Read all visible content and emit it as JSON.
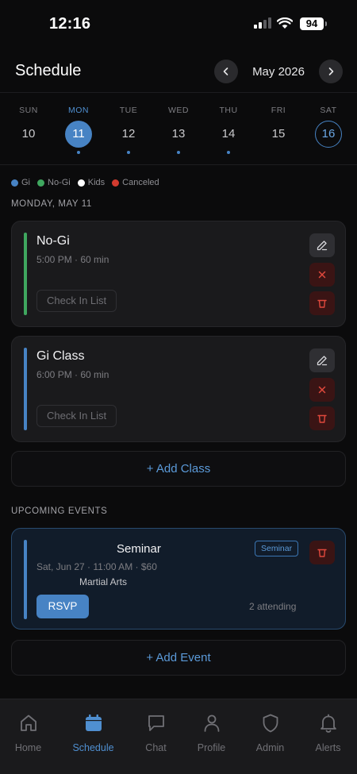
{
  "status_bar": {
    "time": "12:16",
    "battery": "94"
  },
  "header": {
    "title": "Schedule",
    "month": "May 2026"
  },
  "week": [
    {
      "name": "SUN",
      "num": "10",
      "selected": false,
      "today": false,
      "dot": false
    },
    {
      "name": "MON",
      "num": "11",
      "selected": true,
      "today": false,
      "dot": true
    },
    {
      "name": "TUE",
      "num": "12",
      "selected": false,
      "today": false,
      "dot": true
    },
    {
      "name": "WED",
      "num": "13",
      "selected": false,
      "today": false,
      "dot": true
    },
    {
      "name": "THU",
      "num": "14",
      "selected": false,
      "today": false,
      "dot": true
    },
    {
      "name": "FRI",
      "num": "15",
      "selected": false,
      "today": false,
      "dot": false
    },
    {
      "name": "SAT",
      "num": "16",
      "selected": false,
      "today": true,
      "dot": false
    }
  ],
  "legend": [
    {
      "label": "Gi",
      "color": "#4783c4"
    },
    {
      "label": "No-Gi",
      "color": "#3fa75f"
    },
    {
      "label": "Kids",
      "color": "#ffffff"
    },
    {
      "label": "Canceled",
      "color": "#d23b2f"
    }
  ],
  "day_section": {
    "label": "MONDAY, MAY 11"
  },
  "classes": [
    {
      "title": "No-Gi",
      "subtitle": "5:00 PM · 60 min",
      "checkin_label": "Check In List",
      "color": "#3fa75f"
    },
    {
      "title": "Gi Class",
      "subtitle": "6:00 PM · 60 min",
      "checkin_label": "Check In List",
      "color": "#4783c4"
    }
  ],
  "add_class_label": "+ Add Class",
  "events_section": {
    "label": "UPCOMING EVENTS"
  },
  "event": {
    "title": "Seminar",
    "tag": "Seminar",
    "meta": "Sat, Jun 27 · 11:00 AM · $60",
    "location": "Martial Arts",
    "rsvp_label": "RSVP",
    "attending": "2 attending"
  },
  "add_event_label": "+ Add Event",
  "tabs": [
    {
      "label": "Home",
      "icon": "home-icon",
      "active": false
    },
    {
      "label": "Schedule",
      "icon": "calendar-icon",
      "active": true
    },
    {
      "label": "Chat",
      "icon": "chat-icon",
      "active": false
    },
    {
      "label": "Profile",
      "icon": "person-icon",
      "active": false
    },
    {
      "label": "Admin",
      "icon": "shield-icon",
      "active": false
    },
    {
      "label": "Alerts",
      "icon": "bell-icon",
      "active": false
    }
  ]
}
